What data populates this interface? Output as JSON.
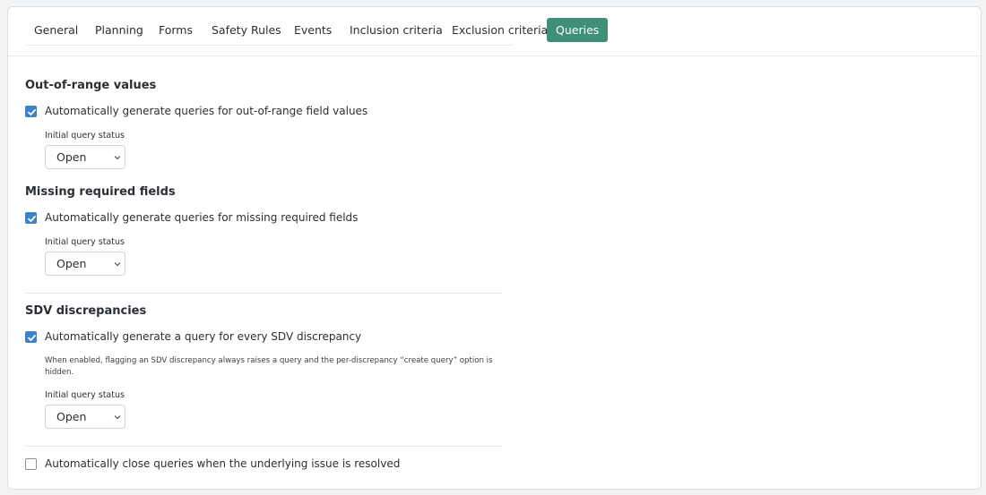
{
  "tabs": [
    {
      "label": "General",
      "active": false
    },
    {
      "label": "Planning",
      "active": false
    },
    {
      "label": "Forms",
      "active": false
    },
    {
      "label": "Safety Rules",
      "active": false
    },
    {
      "label": "Events",
      "active": false
    },
    {
      "label": "Inclusion criteria",
      "active": false
    },
    {
      "label": "Exclusion criteria",
      "active": false
    },
    {
      "label": "Queries",
      "active": true
    }
  ],
  "sections": {
    "out_of_range": {
      "title": "Out-of-range values",
      "checkbox_label": "Automatically generate queries for out-of-range field values",
      "checked": true,
      "status_label": "Initial query status",
      "status_value": "Open"
    },
    "missing_required": {
      "title": "Missing required fields",
      "checkbox_label": "Automatically generate queries for missing required fields",
      "checked": true,
      "status_label": "Initial query status",
      "status_value": "Open"
    },
    "sdv": {
      "title": "SDV discrepancies",
      "checkbox_label": "Automatically generate a query for every SDV discrepancy",
      "checked": true,
      "help_text": "When enabled, flagging an SDV discrepancy always raises a query and the per-discrepancy “create query” option is hidden.",
      "status_label": "Initial query status",
      "status_value": "Open"
    },
    "auto_close": {
      "checkbox_label": "Automatically close queries when the underlying issue is resolved",
      "checked": false
    }
  },
  "colors": {
    "accent": "#3f8f79",
    "checkbox": "#3b82c9"
  },
  "icons": {
    "check": "check-icon",
    "select_arrow": "chevron-down-icon"
  }
}
